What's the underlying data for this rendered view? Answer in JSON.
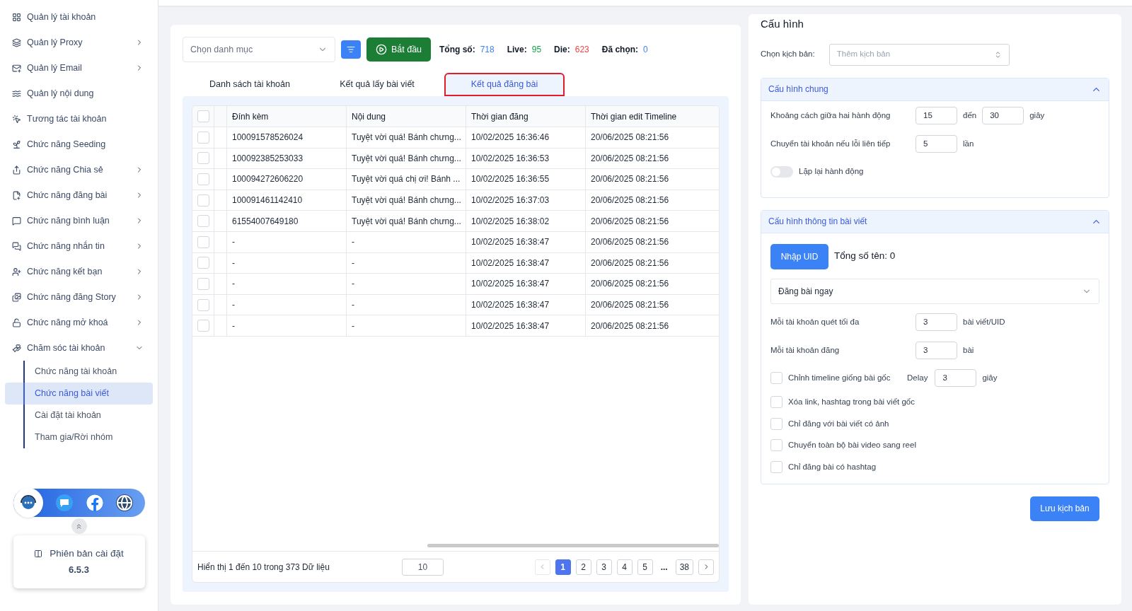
{
  "sidebar": {
    "items": [
      {
        "label": "Quản lý tài khoản",
        "kind": "link"
      },
      {
        "label": "Quản lý Proxy",
        "kind": "group",
        "expanded": false
      },
      {
        "label": "Quản lý Email",
        "kind": "group",
        "expanded": false
      },
      {
        "label": "Quản lý nội dung",
        "kind": "link"
      },
      {
        "label": "Tương tác tài khoản",
        "kind": "link"
      },
      {
        "label": "Chức năng Seeding",
        "kind": "link"
      },
      {
        "label": "Chức năng Chia sẻ",
        "kind": "group",
        "expanded": false
      },
      {
        "label": "Chức năng đăng bài",
        "kind": "group",
        "expanded": false
      },
      {
        "label": "Chức năng bình luận",
        "kind": "group",
        "expanded": false
      },
      {
        "label": "Chức năng nhắn tin",
        "kind": "group",
        "expanded": false
      },
      {
        "label": "Chức năng kết bạn",
        "kind": "group",
        "expanded": false
      },
      {
        "label": "Chức năng đăng Story",
        "kind": "group",
        "expanded": false
      },
      {
        "label": "Chức năng mở khoá",
        "kind": "group",
        "expanded": false
      },
      {
        "label": "Chăm sóc tài khoản",
        "kind": "group",
        "expanded": true,
        "children": [
          {
            "label": "Chức năng tài khoản",
            "selected": false
          },
          {
            "label": "Chức năng bài viết",
            "selected": true
          },
          {
            "label": "Cài đặt tài khoản",
            "selected": false
          },
          {
            "label": "Tham gia/Rời nhóm",
            "selected": false
          }
        ]
      }
    ],
    "version": {
      "label": "Phiên bản cài đặt",
      "value": "6.5.3"
    }
  },
  "toolbar": {
    "category": {
      "placeholder": "Chọn danh mục"
    },
    "start_button": "Bắt đầu",
    "stats": [
      {
        "label": "Tổng số:",
        "value": "718",
        "color": "#3b82f6"
      },
      {
        "label": "Live:",
        "value": "95",
        "color": "#16a34a"
      },
      {
        "label": "Die:",
        "value": "623",
        "color": "#ef4444"
      },
      {
        "label": "Đã chọn:",
        "value": "0",
        "color": "#3b82f6"
      }
    ]
  },
  "tabs": [
    {
      "label": "Danh sách tài khoản",
      "selected": false,
      "highlighted": false
    },
    {
      "label": "Kết quả lấy bài viết",
      "selected": false,
      "highlighted": false
    },
    {
      "label": "Kết quả đăng bài",
      "selected": true,
      "highlighted": true
    }
  ],
  "table": {
    "columns": [
      "Đính kèm",
      "Nội dung",
      "Thời gian đăng",
      "Thời gian edit Timeline"
    ],
    "all_checked": false,
    "rows": [
      {
        "checked": false,
        "cells": [
          "100091578526024",
          "Tuyệt vời quá! Bánh chưng...",
          "10/02/2025 16:36:46",
          "20/06/2025 08:21:56"
        ]
      },
      {
        "checked": false,
        "cells": [
          "100092385253033",
          "Tuyệt vời quá! Bánh chưng...",
          "10/02/2025 16:36:53",
          "20/06/2025 08:21:56"
        ]
      },
      {
        "checked": false,
        "cells": [
          "100094272606220",
          "Tuyệt vời quá chị ơi! Bánh ...",
          "10/02/2025 16:36:55",
          "20/06/2025 08:21:56"
        ]
      },
      {
        "checked": false,
        "cells": [
          "100091461142410",
          "Tuyệt vời quá! Bánh chưng...",
          "10/02/2025 16:37:03",
          "20/06/2025 08:21:56"
        ]
      },
      {
        "checked": false,
        "cells": [
          "61554007649180",
          "Tuyệt vời quá! Bánh chưng...",
          "10/02/2025 16:38:02",
          "20/06/2025 08:21:56"
        ]
      },
      {
        "checked": false,
        "cells": [
          "-",
          "-",
          "10/02/2025 16:38:47",
          "20/06/2025 08:21:56"
        ]
      },
      {
        "checked": false,
        "cells": [
          "-",
          "-",
          "10/02/2025 16:38:47",
          "20/06/2025 08:21:56"
        ]
      },
      {
        "checked": false,
        "cells": [
          "-",
          "-",
          "10/02/2025 16:38:47",
          "20/06/2025 08:21:56"
        ]
      },
      {
        "checked": false,
        "cells": [
          "-",
          "-",
          "10/02/2025 16:38:47",
          "20/06/2025 08:21:56"
        ]
      },
      {
        "checked": false,
        "cells": [
          "-",
          "-",
          "10/02/2025 16:38:47",
          "20/06/2025 08:21:56"
        ]
      }
    ],
    "summary": "Hiển thị 1 đến 10 trong 373 Dữ liệu",
    "page_size": "10",
    "pages": [
      {
        "label": "1",
        "kind": "page",
        "selected": true
      },
      {
        "label": "2",
        "kind": "page",
        "selected": false
      },
      {
        "label": "3",
        "kind": "page",
        "selected": false
      },
      {
        "label": "4",
        "kind": "page",
        "selected": false
      },
      {
        "label": "5",
        "kind": "page",
        "selected": false
      },
      {
        "label": "...",
        "kind": "ellipsis"
      },
      {
        "label": "38",
        "kind": "page",
        "selected": false
      }
    ]
  },
  "config": {
    "title": "Cấu hình",
    "script_label": "Chọn kịch bản:",
    "script_placeholder": "Thêm kịch bản",
    "sections": [
      {
        "title": "Cấu hình chung",
        "expanded": true,
        "rows": [
          {
            "kind": "range",
            "label": "Khoảng cách giữa hai hành động",
            "from": "15",
            "sep": "đến",
            "to": "30",
            "unit": "giây"
          },
          {
            "kind": "number",
            "label": "Chuyển tài khoản nếu lỗi liên tiếp",
            "value": "5",
            "unit": "lần"
          },
          {
            "kind": "toggle",
            "label": "Lặp lại hành động",
            "on": false
          }
        ]
      },
      {
        "title": "Cấu hình thông tin bài viết",
        "expanded": true,
        "rows": [
          {
            "kind": "uid",
            "button": "Nhập UID",
            "text": "Tổng số tên: 0"
          },
          {
            "kind": "select",
            "value": "Đăng bài ngay"
          },
          {
            "kind": "number",
            "label": "Mỗi tài khoản quét tối đa",
            "value": "3",
            "unit": "bài viết/UID"
          },
          {
            "kind": "number",
            "label": "Mỗi tài khoản đăng",
            "value": "3",
            "unit": "bài"
          },
          {
            "kind": "check_delay",
            "label": "Chỉnh timeline giống bài gốc",
            "checked": false,
            "delay_label": "Delay",
            "value": "3",
            "unit": "giây"
          },
          {
            "kind": "check",
            "label": "Xóa link, hashtag trong bài viết gốc",
            "checked": false
          },
          {
            "kind": "check",
            "label": "Chỉ đăng với bài viết có ảnh",
            "checked": false
          },
          {
            "kind": "check",
            "label": "Chuyển toàn bộ bài video sang reel",
            "checked": false
          },
          {
            "kind": "check",
            "label": "Chỉ đăng bài có hashtag",
            "checked": false
          }
        ]
      }
    ],
    "save_button": "Lưu kịch bản"
  }
}
